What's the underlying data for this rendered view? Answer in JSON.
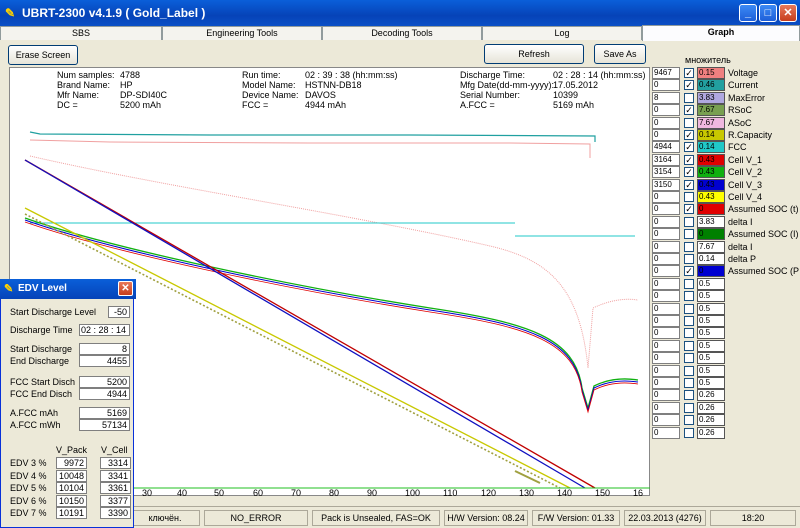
{
  "window": {
    "title": "UBRT-2300 v4.1.9  ( Gold_Label )"
  },
  "tabs": [
    "SBS",
    "Engineering Tools",
    "Decoding Tools",
    "Log",
    "Graph"
  ],
  "toolbar": {
    "erase": "Erase Screen",
    "refresh": "Refresh",
    "save_as": "Save As"
  },
  "info": {
    "c1": [
      [
        "Num samples:",
        "4788"
      ],
      [
        "Brand Name:",
        "HP"
      ],
      [
        "Mfr Name:",
        "DP-SDI40C"
      ],
      [
        "DC =",
        "5200 mAh"
      ]
    ],
    "c2": [
      [
        "Run time:",
        "02 : 39 : 38 (hh:mm:ss)"
      ],
      [
        "Model Name:",
        "HSTNN-DB18"
      ],
      [
        "Device Name:",
        "DAVOS"
      ],
      [
        "FCC =",
        "4944 mAh"
      ]
    ],
    "c3": [
      [
        "Discharge Time:",
        "02 : 28 : 14 (hh:mm:ss)"
      ],
      [
        "Mfg Date(dd-mm-yyyy):",
        "17.05.2012"
      ],
      [
        "Serial Number:",
        "10399"
      ],
      [
        "A.FCC =",
        "5169 mAh"
      ]
    ]
  },
  "x_ticks": [
    "30",
    "40",
    "50",
    "60",
    "70",
    "80",
    "90",
    "100",
    "110",
    "120",
    "130",
    "140",
    "150",
    "16"
  ],
  "side": {
    "header": "множитель",
    "rows": [
      {
        "num": "9467",
        "checked": true,
        "mult": "0.15",
        "color": "#f08080",
        "label": "Voltage"
      },
      {
        "num": "0",
        "checked": true,
        "mult": "0.46",
        "color": "#22a0a0",
        "label": "Current"
      },
      {
        "num": "8",
        "checked": false,
        "mult": "3.83",
        "color": "#b0a8e0",
        "label": "MaxError"
      },
      {
        "num": "0",
        "checked": true,
        "mult": "7.67",
        "color": "#78a050",
        "label": "RSoC"
      },
      {
        "num": "0",
        "checked": false,
        "mult": "7.67",
        "color": "#f0b8e0",
        "label": "ASoC"
      },
      {
        "num": "0",
        "checked": true,
        "mult": "0.14",
        "color": "#c8c800",
        "label": "R.Capacity"
      },
      {
        "num": "4944",
        "checked": true,
        "mult": "0.14",
        "color": "#20c8c8",
        "label": "FCC"
      },
      {
        "num": "3164",
        "checked": true,
        "mult": "0.43",
        "color": "#e00000",
        "label": "Cell V_1"
      },
      {
        "num": "3154",
        "checked": true,
        "mult": "0.43",
        "color": "#10b010",
        "label": "Cell V_2"
      },
      {
        "num": "3150",
        "checked": true,
        "mult": "0.43",
        "color": "#0000d0",
        "label": "Cell V_3"
      },
      {
        "num": "0",
        "checked": false,
        "mult": "0.43",
        "color": "#ffff00",
        "label": "Cell V_4"
      },
      {
        "num": "0",
        "checked": true,
        "mult": "0",
        "color": "#e00000",
        "label": "Assumed SOC (t)"
      },
      {
        "num": "0",
        "checked": false,
        "mult": "3.83",
        "color": "#ffffff",
        "label": "delta I"
      },
      {
        "num": "0",
        "checked": false,
        "mult": "0",
        "color": "#008000",
        "label": "Assumed SOC (I)"
      },
      {
        "num": "0",
        "checked": false,
        "mult": "7.67",
        "color": "#ffffff",
        "label": "delta I"
      },
      {
        "num": "0",
        "checked": false,
        "mult": "0.14",
        "color": "#ffffff",
        "label": "delta P"
      },
      {
        "num": "0",
        "checked": true,
        "mult": "0",
        "color": "#0000d0",
        "label": "Assumed SOC (P"
      },
      {
        "num": "0",
        "checked": false,
        "mult": "0.5",
        "color": "#ffffff",
        "label": ""
      },
      {
        "num": "0",
        "checked": false,
        "mult": "0.5",
        "color": "#ffffff",
        "label": ""
      },
      {
        "num": "0",
        "checked": false,
        "mult": "0.5",
        "color": "#ffffff",
        "label": ""
      },
      {
        "num": "0",
        "checked": false,
        "mult": "0.5",
        "color": "#ffffff",
        "label": ""
      },
      {
        "num": "0",
        "checked": false,
        "mult": "0.5",
        "color": "#ffffff",
        "label": ""
      },
      {
        "num": "0",
        "checked": false,
        "mult": "0.5",
        "color": "#ffffff",
        "label": ""
      },
      {
        "num": "0",
        "checked": false,
        "mult": "0.5",
        "color": "#ffffff",
        "label": ""
      },
      {
        "num": "0",
        "checked": false,
        "mult": "0.5",
        "color": "#ffffff",
        "label": ""
      },
      {
        "num": "0",
        "checked": false,
        "mult": "0.5",
        "color": "#ffffff",
        "label": ""
      },
      {
        "num": "0",
        "checked": false,
        "mult": "0.26",
        "color": "#ffffff",
        "label": ""
      },
      {
        "num": "0",
        "checked": false,
        "mult": "0.26",
        "color": "#ffffff",
        "label": ""
      },
      {
        "num": "0",
        "checked": false,
        "mult": "0.26",
        "color": "#ffffff",
        "label": ""
      },
      {
        "num": "0",
        "checked": false,
        "mult": "0.26",
        "color": "#ffffff",
        "label": ""
      }
    ]
  },
  "status": [
    "ключён.",
    "NO_ERROR",
    "Pack is Unsealed, FAS=OK",
    "H/W Version: 08.24",
    "F/W Version: 01.33",
    "22.03.2013 (4276)",
    "18:20"
  ],
  "dialog": {
    "title": "EDV Level",
    "start_level_label": "Start Discharge Level",
    "start_level": "-50",
    "dis_time_label": "Discharge Time",
    "dis_time": "02 : 28 : 14",
    "start_dis_label": "Start Discharge",
    "start_dis": "8",
    "end_dis_label": "End  Discharge",
    "end_dis": "4455",
    "fcc_start_label": "FCC Start Disch",
    "fcc_start": "5200",
    "fcc_end_label": "FCC End  Disch",
    "fcc_end": "4944",
    "afcc_mah_label": "A.FCC mAh",
    "afcc_mah": "5169",
    "afcc_mwh_label": "A.FCC mWh",
    "afcc_mwh": "57134",
    "col_pack": "V_Pack",
    "col_cell": "V_Cell",
    "edv": [
      [
        "EDV  3 %",
        "9972",
        "3314"
      ],
      [
        "EDV  4 %",
        "10048",
        "3341"
      ],
      [
        "EDV  5 %",
        "10104",
        "3361"
      ],
      [
        "EDV  6 %",
        "10150",
        "3377"
      ],
      [
        "EDV  7 %",
        "10191",
        "3390"
      ]
    ]
  }
}
